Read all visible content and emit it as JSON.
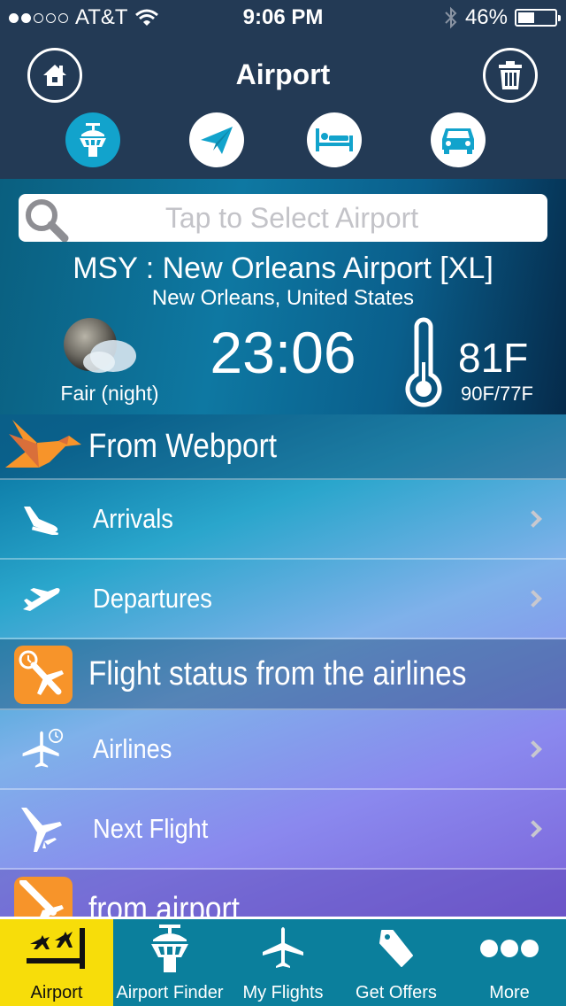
{
  "status_bar": {
    "signal_dots_filled": 2,
    "signal_dots_total": 5,
    "carrier": "AT&T",
    "time": "9:06 PM",
    "battery": "46%",
    "battery_level": 0.46
  },
  "nav": {
    "title": "Airport",
    "left_button": "home-icon",
    "right_button": "trash-icon",
    "tabs": [
      {
        "icon": "control-tower-icon",
        "active": true
      },
      {
        "icon": "paper-plane-icon",
        "active": false
      },
      {
        "icon": "bed-icon",
        "active": false
      },
      {
        "icon": "car-icon",
        "active": false
      }
    ]
  },
  "hero": {
    "search_placeholder": "Tap to Select Airport",
    "airport_name": "MSY : New Orleans Airport [XL]",
    "airport_city": "New Orleans, United States",
    "weather_condition": "Fair (night)",
    "local_time": "23:06",
    "temperature": "81F",
    "temp_range": "90F/77F"
  },
  "sections": [
    {
      "title": "From Webport",
      "icon": "origami-bird-icon",
      "items": [
        {
          "label": "Arrivals",
          "icon": "arrival-plane-icon"
        },
        {
          "label": "Departures",
          "icon": "departure-plane-icon"
        }
      ]
    },
    {
      "title": "Flight status from the airlines",
      "icon": "flight-clock-icon",
      "items": [
        {
          "label": "Airlines",
          "icon": "airliner-clock-icon"
        },
        {
          "label": "Next Flight",
          "icon": "plane-icon"
        }
      ]
    },
    {
      "title": "from airport",
      "icon": "airport-departure-icon",
      "items": []
    }
  ],
  "tabbar": {
    "colors": {
      "active_bg": "#f7dd0a",
      "bg": "#0b7f9c"
    },
    "items": [
      {
        "label": "Airport",
        "icon": "airport-runway-icon",
        "active": true
      },
      {
        "label": "Airport Finder",
        "icon": "control-tower-icon",
        "active": false
      },
      {
        "label": "My Flights",
        "icon": "airplane-icon",
        "active": false
      },
      {
        "label": "Get Offers",
        "icon": "tag-icon",
        "active": false
      },
      {
        "label": "More",
        "icon": "more-dots-icon",
        "active": false
      }
    ]
  }
}
